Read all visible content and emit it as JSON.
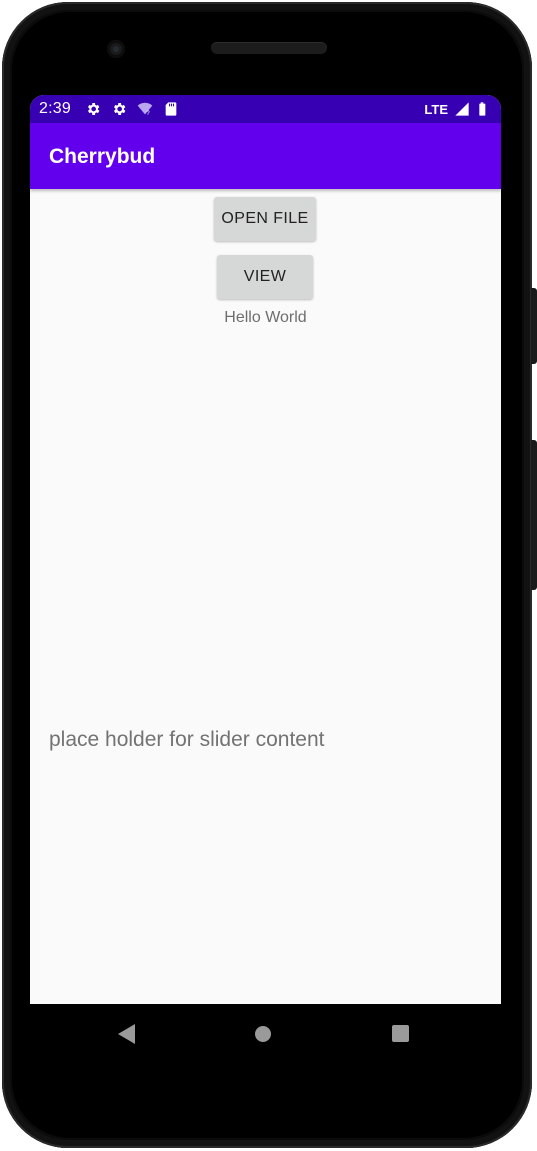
{
  "status_bar": {
    "time": "2:39",
    "network": "LTE",
    "icons": [
      "settings-icon",
      "settings-icon",
      "wifi-question-icon",
      "sd-card-icon",
      "signal-icon",
      "battery-icon"
    ],
    "color": "#3700b3"
  },
  "app_bar": {
    "title": "Cherrybud",
    "color": "#6200ee"
  },
  "main": {
    "open_file_label": "OPEN FILE",
    "view_label": "VIEW",
    "hello_text": "Hello World",
    "slider_placeholder": "place holder for slider content"
  },
  "nav_bar": {
    "icons": [
      "back-icon",
      "home-icon",
      "recents-icon"
    ]
  }
}
